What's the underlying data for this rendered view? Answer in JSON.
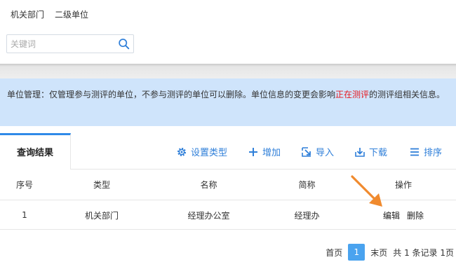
{
  "top_tabs": [
    "机关部门",
    "二级单位"
  ],
  "search": {
    "placeholder": "关键词",
    "value": ""
  },
  "banner": {
    "text_before": "单位管理：仅管理参与测评的单位，不参与测评的单位可以删除。单位信息的变更会影响",
    "highlight": "正在测评",
    "text_after": "的测评组相关信息。"
  },
  "toolbar": {
    "result_tab": "查询结果",
    "set_type": "设置类型",
    "add": "增加",
    "import": "导入",
    "download": "下载",
    "sort": "排序"
  },
  "table": {
    "headers": [
      "序号",
      "类型",
      "名称",
      "简称",
      "操作"
    ],
    "rows": [
      {
        "index": "1",
        "type": "机关部门",
        "name": "经理办公室",
        "short": "经理办",
        "edit": "编辑",
        "delete": "删除"
      }
    ]
  },
  "pager": {
    "first": "首页",
    "current": "1",
    "last": "末页",
    "summary": "共 1 条记录 1页"
  },
  "colors": {
    "accent": "#2f8ae8",
    "banner_bg": "#cfe4fb",
    "highlight": "#e6191f",
    "arrow": "#f08a2e"
  }
}
